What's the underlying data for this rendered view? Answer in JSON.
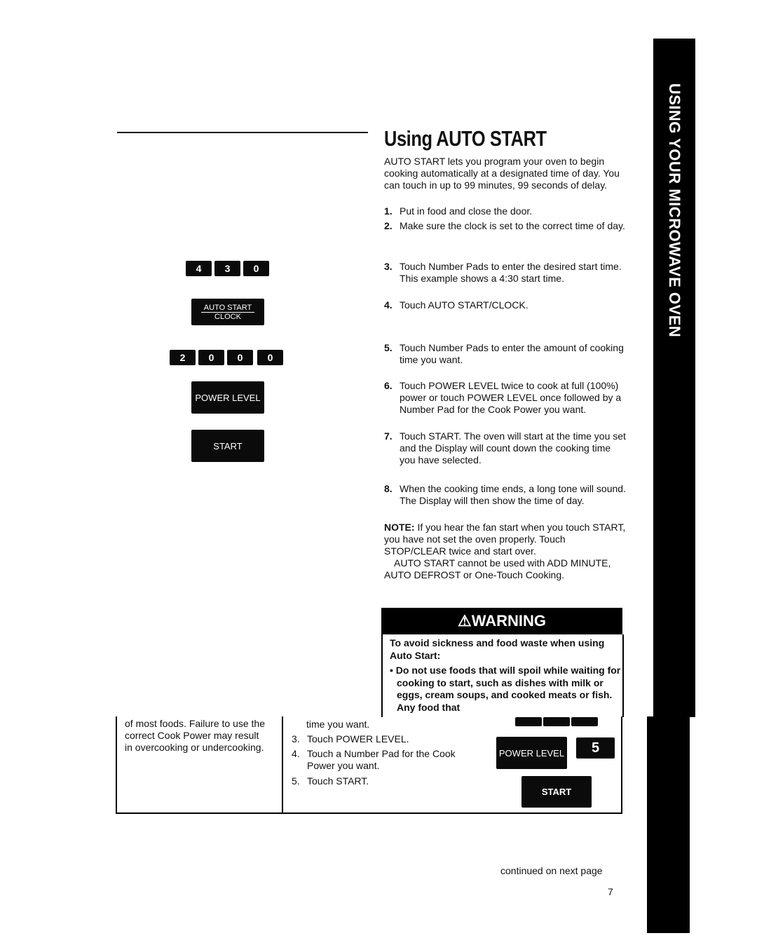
{
  "sidebar": {
    "label": "USING YOUR MICROWAVE OVEN"
  },
  "main": {
    "title": "Using AUTO START",
    "intro": "AUTO START lets you program your oven to begin cooking automatically at a designated time of day. You can touch in up to 99 minutes, 99 seconds of delay.",
    "steps": [
      {
        "num": "1.",
        "text": "Put in food and close the door."
      },
      {
        "num": "2.",
        "text": "Make sure the clock is set to the correct time of day."
      },
      {
        "num": "3.",
        "text": "Touch Number Pads to enter the desired start time. This example shows a 4:30 start time."
      },
      {
        "num": "4.",
        "text": "Touch AUTO START/CLOCK."
      },
      {
        "num": "5.",
        "text": "Touch Number Pads to enter the amount of cooking time you want."
      },
      {
        "num": "6.",
        "text": "Touch POWER LEVEL twice to cook at full (100%) power or touch POWER LEVEL once followed by a Number Pad for the Cook Power you want."
      },
      {
        "num": "7.",
        "text": "Touch START. The oven will start at the time you set and the Display will count down the cooking time you have selected."
      },
      {
        "num": "8.",
        "text": "When the cooking time ends, a long tone will sound. The Display will then show the time of day."
      }
    ],
    "note_label": "NOTE:",
    "note_text": " If you hear the fan start when you touch START, you have not set the oven properly. Touch STOP/CLEAR twice and start over.",
    "note_text2": "AUTO START cannot be used with ADD MINUTE, AUTO DEFROST or One-Touch Cooking."
  },
  "pads": {
    "start_time": [
      "4",
      "3",
      "0"
    ],
    "auto_start": "AUTO START",
    "clock": "CLOCK",
    "cook_time": [
      "2",
      "0",
      "0",
      "0"
    ],
    "power_level": "POWER LEVEL",
    "start": "START"
  },
  "warning": {
    "heading": "WARNING",
    "intro": "To avoid sickness and food waste when using Auto Start:",
    "bullet": "Do not use foods that will spoil while waiting for cooking to start, such as dishes with milk or eggs, cream soups, and cooked meats or fish. Any food that"
  },
  "lower": {
    "left_text": "of most foods. Failure to use the correct Cook Power may result in overcooking or undercooking.",
    "line0": "time you want.",
    "steps": [
      {
        "num": "3.",
        "text": "Touch POWER LEVEL."
      },
      {
        "num": "4.",
        "text": "Touch a Number Pad for the Cook Power you want."
      },
      {
        "num": "5.",
        "text": "Touch START."
      }
    ],
    "power_level": "POWER LEVEL",
    "digit": "5",
    "start": "START"
  },
  "footer": {
    "continued": "continued on next page",
    "page_number": "7"
  }
}
